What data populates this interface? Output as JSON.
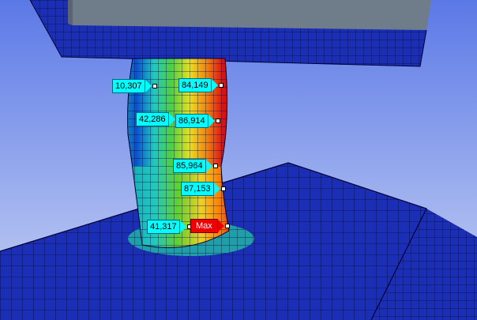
{
  "probes": [
    {
      "value": "10,307"
    },
    {
      "value": "84,149"
    },
    {
      "value": "42,286"
    },
    {
      "value": "86,914"
    },
    {
      "value": "85,964"
    },
    {
      "value": "87,153"
    },
    {
      "value": "41,317"
    },
    {
      "value": "Max"
    }
  ],
  "colors": {
    "background_top": "#5b79e6",
    "background_bottom": "#c8d3f4",
    "mesh_blue": "#1a2fb5",
    "mesh_line": "#000033",
    "probe_fill": "#00ffff",
    "max_fill": "#ee0000",
    "plate_top": "#6f7c8a"
  }
}
